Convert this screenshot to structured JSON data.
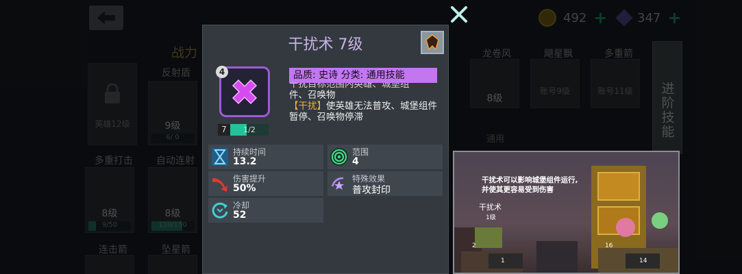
{
  "currency": {
    "coins": "492",
    "gems": "347"
  },
  "background": {
    "power_label": "战力",
    "mid_label": "通用",
    "right_tab": "进阶技能",
    "cards": [
      {
        "title": "",
        "level": "",
        "locked": "英雄12级"
      },
      {
        "title": "反射盾",
        "badge": "5",
        "overlay": "反弹",
        "level": "9级",
        "progress_text": "6/ 0"
      },
      {
        "title": "龙卷风",
        "badge": "4",
        "overlay": "防御",
        "level": "8级"
      },
      {
        "title": "飓星飘",
        "badge": "3",
        "locked": "账号9级"
      },
      {
        "title": "多重箭",
        "badge": "3",
        "locked": "账号11级"
      },
      {
        "title": "多重打击",
        "badge": "3",
        "overlay": "伤害",
        "level": "8级",
        "progress_text": "9/50"
      },
      {
        "title": "自动连射",
        "badge": "3",
        "overlay": "伤害",
        "level": "8级",
        "progress_text": "110/150"
      },
      {
        "title": "连击箭",
        "badge": "3"
      },
      {
        "title": "坠星箭",
        "badge": "3"
      }
    ]
  },
  "dialog": {
    "title": "干扰术 7级",
    "icon_badge": "4",
    "level": "7",
    "progress_text": "1/2",
    "progress_fraction": 0.5,
    "quality_text": "品质: 史诗  分类: 通用技能",
    "desc_cut": "干扰目标范围内英雄、城堡组",
    "desc_line2": "件、召唤物",
    "desc_tag": "【干扰】",
    "desc_rest": "使英雄无法普攻、城堡组件暂停、召唤物停滞",
    "stats": [
      {
        "icon": "hourglass-icon",
        "label": "持续时间",
        "value": "13.2"
      },
      {
        "icon": "swirl-icon",
        "label": "范围",
        "value": "4"
      },
      {
        "icon": "arrow-up-damage-icon",
        "label": "伤害提升",
        "value": "50%"
      },
      {
        "icon": "star-special-icon",
        "label": "特殊效果",
        "value": "普攻封印"
      },
      {
        "icon": "cooldown-icon",
        "label": "冷却",
        "value": "52"
      }
    ]
  },
  "preview": {
    "caption_line1": "干扰术可以影响城堡组件运行,",
    "caption_line2": "并使其更容易受到伤害",
    "skill_name": "干扰术",
    "skill_level": "1级",
    "num_left": "2",
    "num_mid": "1",
    "num_right": "16",
    "num_bottom": "14"
  },
  "colors": {
    "accent_purple": "#c277f0",
    "bar_green": "#22c39a",
    "close_x": "#bfeee8"
  }
}
